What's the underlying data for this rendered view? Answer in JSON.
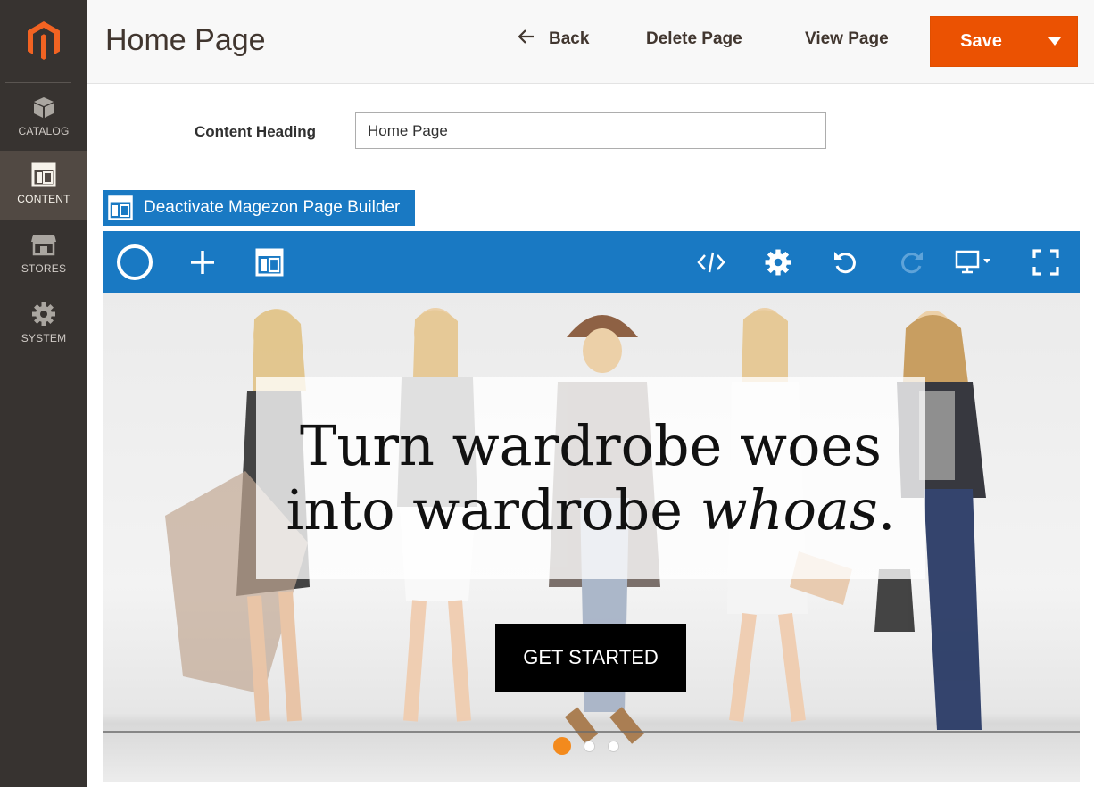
{
  "sidebar": {
    "logo": "magento-logo",
    "items": [
      {
        "label": "CATALOG",
        "icon": "cube-icon",
        "active": false
      },
      {
        "label": "CONTENT",
        "icon": "layout-icon",
        "active": true
      },
      {
        "label": "STORES",
        "icon": "store-icon",
        "active": false
      },
      {
        "label": "SYSTEM",
        "icon": "gear-icon",
        "active": false
      }
    ]
  },
  "header": {
    "title": "Home Page",
    "back_label": "Back",
    "delete_label": "Delete Page",
    "view_label": "View Page",
    "save_label": "Save"
  },
  "form": {
    "content_heading_label": "Content Heading",
    "content_heading_value": "Home Page"
  },
  "builder": {
    "deactivate_label": "Deactivate Magezon Page Builder",
    "toolbar_icons": [
      "magezon-logo-icon",
      "plus-icon",
      "layout-icon",
      "code-icon",
      "gear-icon",
      "undo-icon",
      "redo-icon",
      "desktop-icon",
      "fullscreen-icon"
    ]
  },
  "hero": {
    "line1": "Turn wardrobe woes",
    "line2_prefix": "into wardrobe ",
    "line2_italic": "whoas",
    "line2_suffix": ".",
    "cta_label": "GET STARTED",
    "slide_count": 3,
    "active_slide": 1
  },
  "colors": {
    "sidebar_bg": "#373330",
    "sidebar_active": "#514943",
    "accent": "#eb5202",
    "builder_blue": "#1979c3",
    "dot_active": "#f38a1d"
  }
}
